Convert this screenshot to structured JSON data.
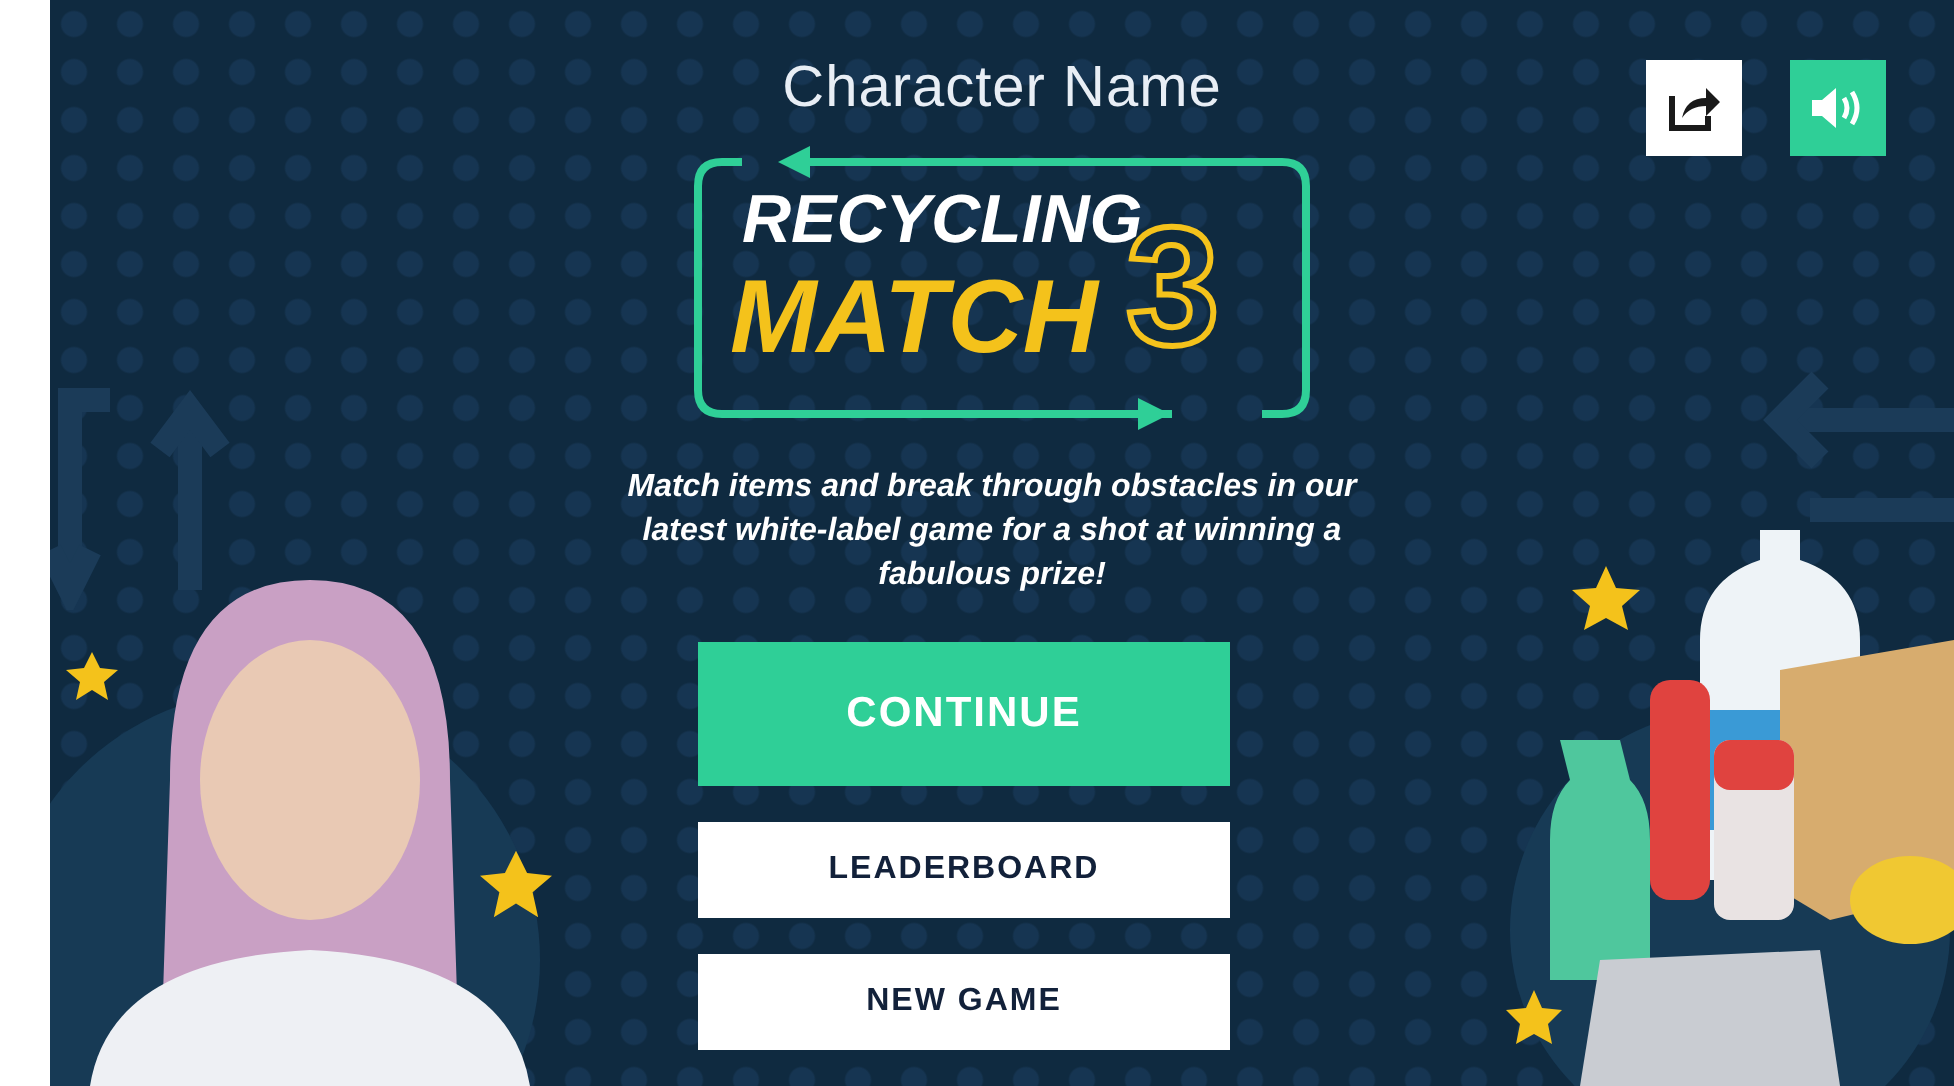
{
  "header": {
    "character_name": "Character Name"
  },
  "logo": {
    "line_1": "RECYCLING",
    "line_2": "MATCH",
    "number": "3"
  },
  "tagline": "Match items and break through obstacles in our latest white-label game for a shot at winning a fabulous prize!",
  "menu_buttons": [
    {
      "label": "CONTINUE",
      "kind": "primary"
    },
    {
      "label": "LEADERBOARD",
      "kind": "secondary"
    },
    {
      "label": "NEW GAME",
      "kind": "secondary"
    }
  ]
}
